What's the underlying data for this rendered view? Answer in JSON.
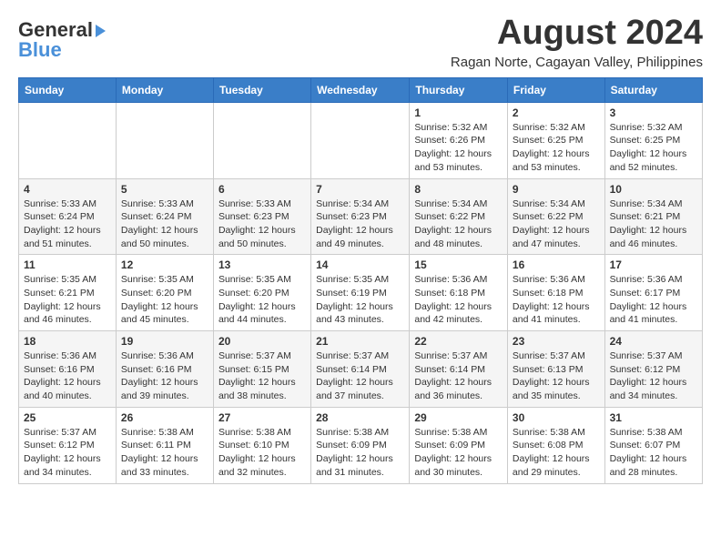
{
  "header": {
    "logo_general": "General",
    "logo_blue": "Blue",
    "month_year": "August 2024",
    "location": "Ragan Norte, Cagayan Valley, Philippines"
  },
  "calendar": {
    "days_of_week": [
      "Sunday",
      "Monday",
      "Tuesday",
      "Wednesday",
      "Thursday",
      "Friday",
      "Saturday"
    ],
    "weeks": [
      [
        {
          "day": "",
          "info": ""
        },
        {
          "day": "",
          "info": ""
        },
        {
          "day": "",
          "info": ""
        },
        {
          "day": "",
          "info": ""
        },
        {
          "day": "1",
          "info": "Sunrise: 5:32 AM\nSunset: 6:26 PM\nDaylight: 12 hours\nand 53 minutes."
        },
        {
          "day": "2",
          "info": "Sunrise: 5:32 AM\nSunset: 6:25 PM\nDaylight: 12 hours\nand 53 minutes."
        },
        {
          "day": "3",
          "info": "Sunrise: 5:32 AM\nSunset: 6:25 PM\nDaylight: 12 hours\nand 52 minutes."
        }
      ],
      [
        {
          "day": "4",
          "info": "Sunrise: 5:33 AM\nSunset: 6:24 PM\nDaylight: 12 hours\nand 51 minutes."
        },
        {
          "day": "5",
          "info": "Sunrise: 5:33 AM\nSunset: 6:24 PM\nDaylight: 12 hours\nand 50 minutes."
        },
        {
          "day": "6",
          "info": "Sunrise: 5:33 AM\nSunset: 6:23 PM\nDaylight: 12 hours\nand 50 minutes."
        },
        {
          "day": "7",
          "info": "Sunrise: 5:34 AM\nSunset: 6:23 PM\nDaylight: 12 hours\nand 49 minutes."
        },
        {
          "day": "8",
          "info": "Sunrise: 5:34 AM\nSunset: 6:22 PM\nDaylight: 12 hours\nand 48 minutes."
        },
        {
          "day": "9",
          "info": "Sunrise: 5:34 AM\nSunset: 6:22 PM\nDaylight: 12 hours\nand 47 minutes."
        },
        {
          "day": "10",
          "info": "Sunrise: 5:34 AM\nSunset: 6:21 PM\nDaylight: 12 hours\nand 46 minutes."
        }
      ],
      [
        {
          "day": "11",
          "info": "Sunrise: 5:35 AM\nSunset: 6:21 PM\nDaylight: 12 hours\nand 46 minutes."
        },
        {
          "day": "12",
          "info": "Sunrise: 5:35 AM\nSunset: 6:20 PM\nDaylight: 12 hours\nand 45 minutes."
        },
        {
          "day": "13",
          "info": "Sunrise: 5:35 AM\nSunset: 6:20 PM\nDaylight: 12 hours\nand 44 minutes."
        },
        {
          "day": "14",
          "info": "Sunrise: 5:35 AM\nSunset: 6:19 PM\nDaylight: 12 hours\nand 43 minutes."
        },
        {
          "day": "15",
          "info": "Sunrise: 5:36 AM\nSunset: 6:18 PM\nDaylight: 12 hours\nand 42 minutes."
        },
        {
          "day": "16",
          "info": "Sunrise: 5:36 AM\nSunset: 6:18 PM\nDaylight: 12 hours\nand 41 minutes."
        },
        {
          "day": "17",
          "info": "Sunrise: 5:36 AM\nSunset: 6:17 PM\nDaylight: 12 hours\nand 41 minutes."
        }
      ],
      [
        {
          "day": "18",
          "info": "Sunrise: 5:36 AM\nSunset: 6:16 PM\nDaylight: 12 hours\nand 40 minutes."
        },
        {
          "day": "19",
          "info": "Sunrise: 5:36 AM\nSunset: 6:16 PM\nDaylight: 12 hours\nand 39 minutes."
        },
        {
          "day": "20",
          "info": "Sunrise: 5:37 AM\nSunset: 6:15 PM\nDaylight: 12 hours\nand 38 minutes."
        },
        {
          "day": "21",
          "info": "Sunrise: 5:37 AM\nSunset: 6:14 PM\nDaylight: 12 hours\nand 37 minutes."
        },
        {
          "day": "22",
          "info": "Sunrise: 5:37 AM\nSunset: 6:14 PM\nDaylight: 12 hours\nand 36 minutes."
        },
        {
          "day": "23",
          "info": "Sunrise: 5:37 AM\nSunset: 6:13 PM\nDaylight: 12 hours\nand 35 minutes."
        },
        {
          "day": "24",
          "info": "Sunrise: 5:37 AM\nSunset: 6:12 PM\nDaylight: 12 hours\nand 34 minutes."
        }
      ],
      [
        {
          "day": "25",
          "info": "Sunrise: 5:37 AM\nSunset: 6:12 PM\nDaylight: 12 hours\nand 34 minutes."
        },
        {
          "day": "26",
          "info": "Sunrise: 5:38 AM\nSunset: 6:11 PM\nDaylight: 12 hours\nand 33 minutes."
        },
        {
          "day": "27",
          "info": "Sunrise: 5:38 AM\nSunset: 6:10 PM\nDaylight: 12 hours\nand 32 minutes."
        },
        {
          "day": "28",
          "info": "Sunrise: 5:38 AM\nSunset: 6:09 PM\nDaylight: 12 hours\nand 31 minutes."
        },
        {
          "day": "29",
          "info": "Sunrise: 5:38 AM\nSunset: 6:09 PM\nDaylight: 12 hours\nand 30 minutes."
        },
        {
          "day": "30",
          "info": "Sunrise: 5:38 AM\nSunset: 6:08 PM\nDaylight: 12 hours\nand 29 minutes."
        },
        {
          "day": "31",
          "info": "Sunrise: 5:38 AM\nSunset: 6:07 PM\nDaylight: 12 hours\nand 28 minutes."
        }
      ]
    ]
  }
}
